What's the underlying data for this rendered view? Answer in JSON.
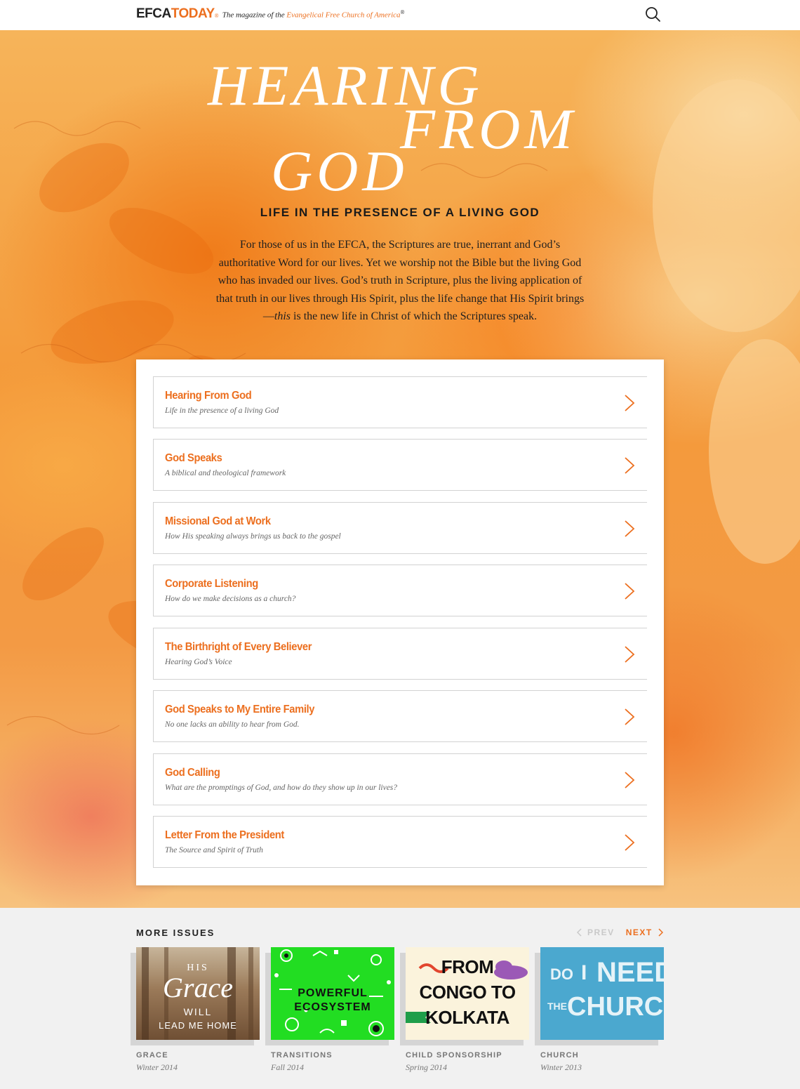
{
  "header": {
    "logo_efca": "EFCA",
    "logo_today": "TODAY",
    "logo_reg": "®",
    "tagline_prefix": "The magazine of the ",
    "tagline_org": "Evangelical Free Church of America",
    "tagline_reg": "®",
    "search_icon": "search-icon"
  },
  "hero": {
    "title_line1": "HEARING",
    "title_line2": "FROM",
    "title_line3": "GOD",
    "subtitle": "LIFE IN THE PRESENCE OF A LIVING GOD",
    "intro_before": "For those of us in the EFCA, the Scriptures are true, inerrant and God’s authoritative Word for our lives. Yet we worship not the Bible but the living God who has invaded our lives. God’s truth in Scripture, plus the living application of that truth in our lives through His Spirit, plus the life change that His Spirit brings—",
    "intro_em": "this",
    "intro_after": " is the new life in Christ of which the Scriptures speak."
  },
  "articles": [
    {
      "title": "Hearing From God",
      "subtitle": "Life in the presence of a living God"
    },
    {
      "title": "God Speaks",
      "subtitle": "A biblical and theological framework"
    },
    {
      "title": "Missional God at Work",
      "subtitle": "How His speaking always brings us back to the gospel"
    },
    {
      "title": "Corporate Listening",
      "subtitle": "How do we make decisions as a church?"
    },
    {
      "title": "The Birthright of Every Believer",
      "subtitle": "Hearing God’s Voice"
    },
    {
      "title": "God Speaks to My Entire Family",
      "subtitle": "No one lacks an ability to hear from God."
    },
    {
      "title": "God Calling",
      "subtitle": "What are the promptings of God, and how do they show up in our lives?"
    },
    {
      "title": "Letter From the President",
      "subtitle": "The Source and Spirit of Truth"
    }
  ],
  "more_issues": {
    "heading": "MORE ISSUES",
    "prev_label": "PREV",
    "next_label": "NEXT",
    "issues": [
      {
        "name": "GRACE",
        "date": "Winter 2014",
        "cover_lines": [
          "HIS",
          "Grace",
          "WILL",
          "LEAD ME HOME"
        ]
      },
      {
        "name": "TRANSITIONS",
        "date": "Fall 2014",
        "cover_lines": [
          "POWERFUL",
          "ECOSYSTEM"
        ]
      },
      {
        "name": "CHILD SPONSORSHIP",
        "date": "Spring 2014",
        "cover_lines": [
          "FROM",
          "CONGO TO",
          "KOLKATA"
        ]
      },
      {
        "name": "CHURCH",
        "date": "Winter 2013",
        "cover_lines": [
          "DO",
          "I",
          "NEED",
          "THE",
          "CHURCH?"
        ]
      }
    ]
  },
  "colors": {
    "accent": "#ec6f1f",
    "text_dark": "#222222",
    "muted": "#777777",
    "disabled": "#c9c9c9"
  }
}
